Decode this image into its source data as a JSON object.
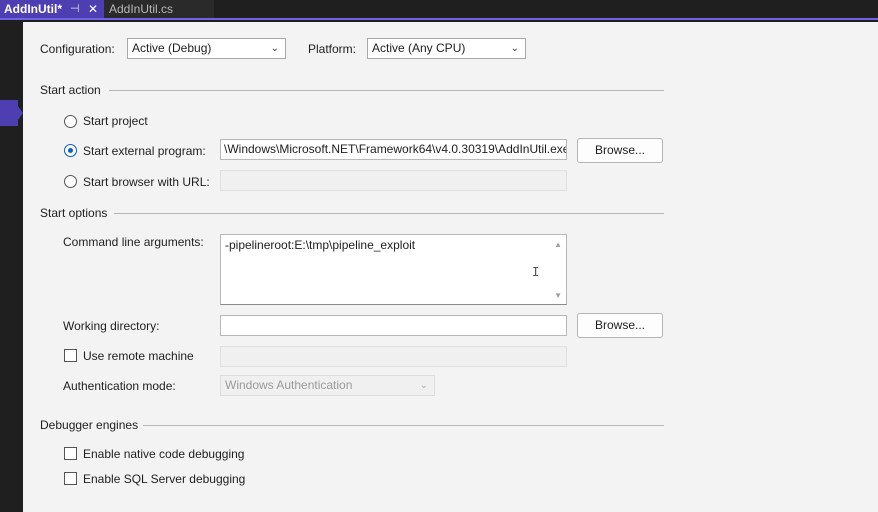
{
  "tabs": {
    "active": "AddInUtil*",
    "pin_glyph": "⊣",
    "close_glyph": "✕",
    "inactive": "AddInUtil.cs"
  },
  "config": {
    "configuration_label": "Configuration:",
    "configuration_value": "Active (Debug)",
    "platform_label": "Platform:",
    "platform_value": "Active (Any CPU)"
  },
  "start_action": {
    "title": "Start action",
    "start_project": "Start project",
    "start_external": "Start external program:",
    "external_path": "\\Windows\\Microsoft.NET\\Framework64\\v4.0.30319\\AddInUtil.exe",
    "start_browser": "Start browser with URL:",
    "browser_url": "",
    "browse_label": "Browse...",
    "selected": "start_external"
  },
  "start_options": {
    "title": "Start options",
    "cmd_label": "Command line arguments:",
    "cmd_value": "-pipelineroot:E:\\tmp\\pipeline_exploit",
    "workdir_label": "Working directory:",
    "workdir_value": "",
    "browse_label": "Browse...",
    "remote_label": "Use remote machine",
    "remote_value": "",
    "remote_checked": false,
    "auth_label": "Authentication mode:",
    "auth_value": "Windows Authentication"
  },
  "debugger": {
    "title": "Debugger engines",
    "native": "Enable native code debugging",
    "native_checked": false,
    "sql": "Enable SQL Server debugging",
    "sql_checked": false
  },
  "icons": {
    "chevron": "chevron-down-icon",
    "scroll_up": "scroll-up-icon",
    "scroll_down": "scroll-down-icon",
    "text_cursor": "i-beam-icon"
  },
  "colors": {
    "accent": "#4d3fb2",
    "radio_selected": "#0a5fc4",
    "panel_bg": "#f3f3f3",
    "chrome_bg": "#1f1f1f"
  }
}
